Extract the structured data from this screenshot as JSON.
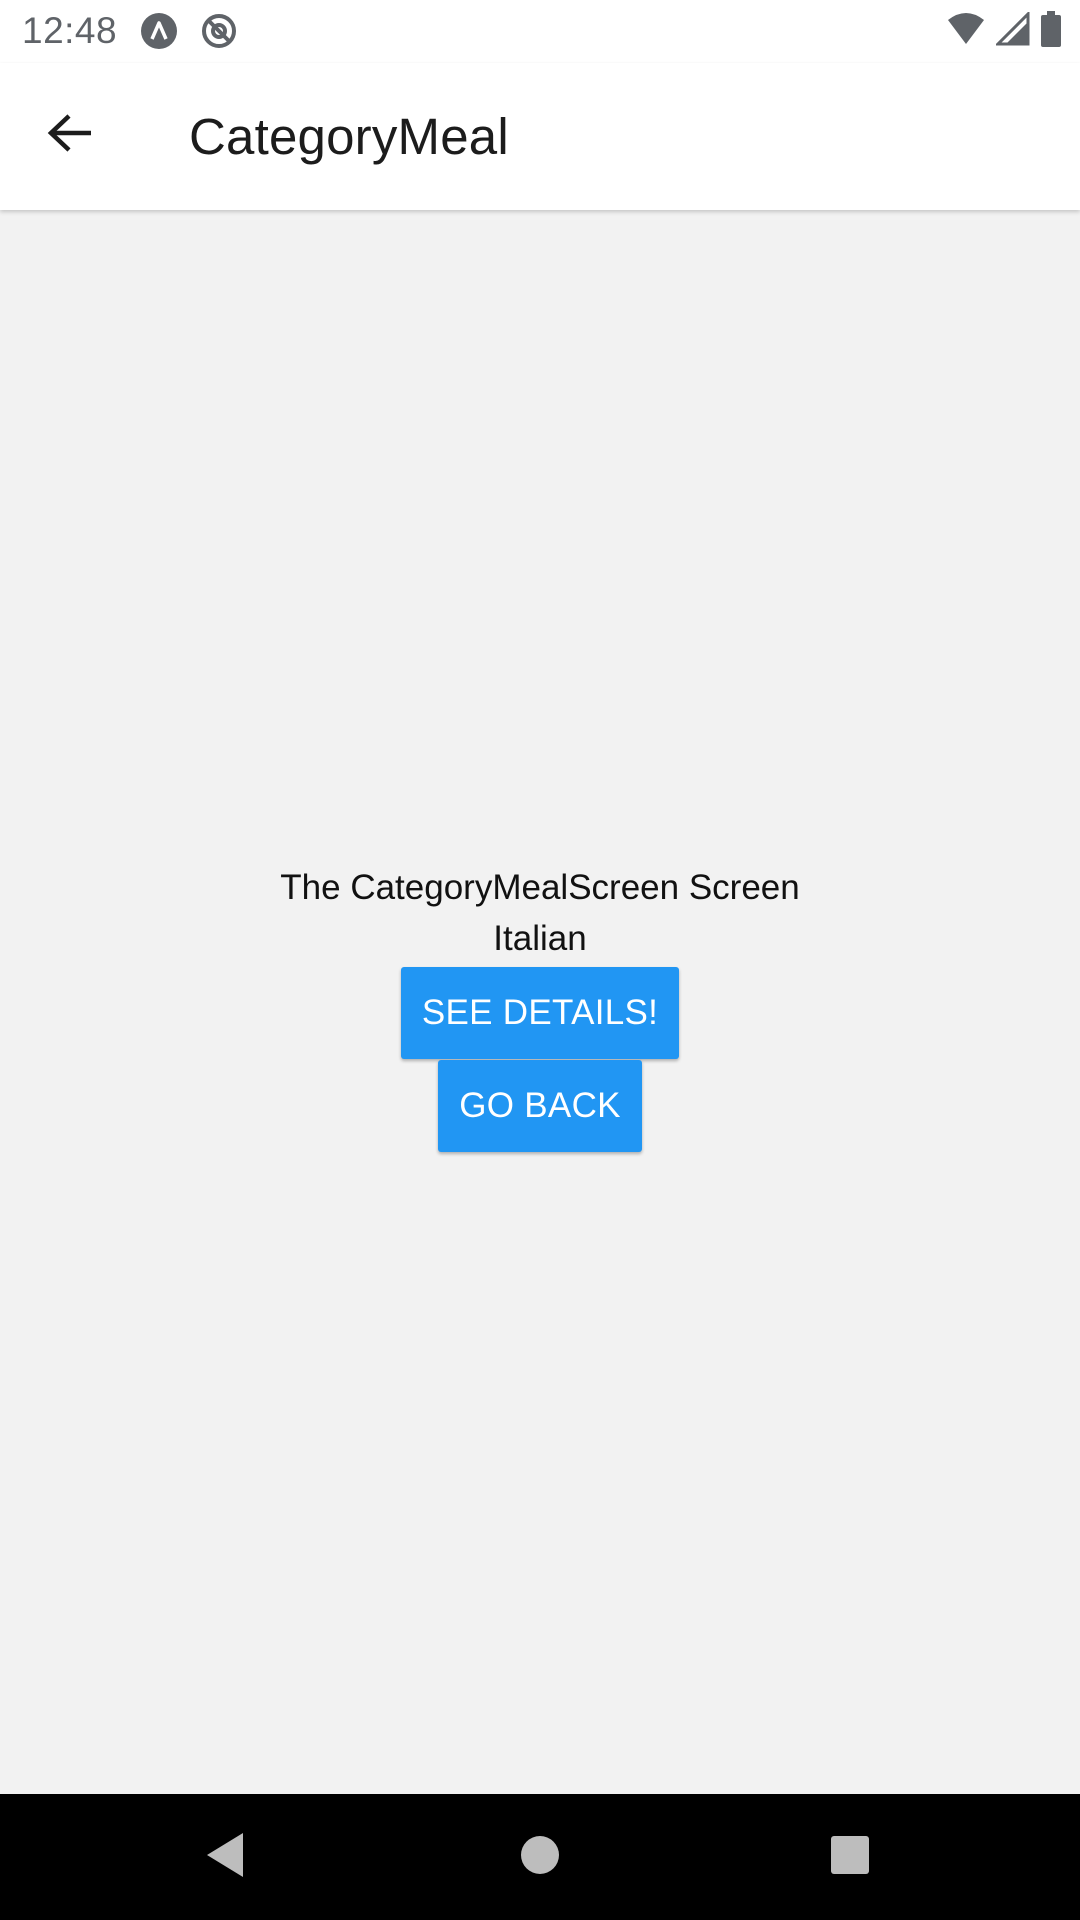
{
  "status_bar": {
    "time": "12:48",
    "icons": [
      "android-studio-icon",
      "at-sign-icon",
      "wifi-icon",
      "cell-signal-icon",
      "battery-icon"
    ]
  },
  "app_bar": {
    "back_icon": "arrow-left-icon",
    "title": "CategoryMeal"
  },
  "main": {
    "screen_label": "The CategoryMealScreen Screen",
    "category_title": "Italian",
    "see_details_label": "SEE DETAILS!",
    "go_back_label": "GO BACK"
  },
  "nav_bar": {
    "icons": [
      "back-triangle-icon",
      "home-circle-icon",
      "recents-square-icon"
    ]
  },
  "colors": {
    "accent": "#2196f3",
    "background": "#f2f2f2",
    "app_bar": "#ffffff",
    "nav_bar": "#000000"
  }
}
